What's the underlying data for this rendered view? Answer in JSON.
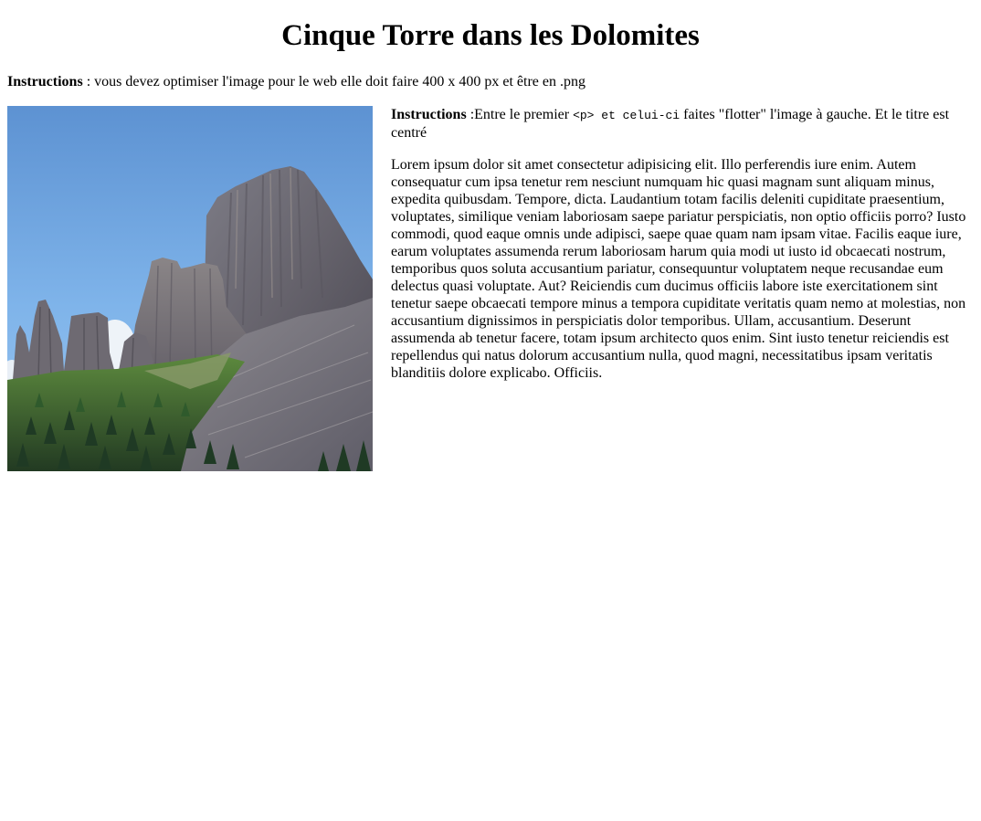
{
  "page": {
    "title": "Cinque Torre dans les Dolomites"
  },
  "intro": {
    "label": "Instructions",
    "text": " : vous devez optimiser l'image pour le web elle doit faire 400 x 400 px et être en .png"
  },
  "image": {
    "alt": "Cinque Torri mountain in the Dolomites"
  },
  "float_instructions": {
    "label": "Instructions",
    "text_before": " :Entre le premier ",
    "code": "<p> et celui-ci",
    "text_after": " faites \"flotter\" l'image à gauche. Et le titre est centré"
  },
  "body_text": "Lorem ipsum dolor sit amet consectetur adipisicing elit. Illo perferendis iure enim. Autem consequatur cum ipsa tenetur rem nesciunt numquam hic quasi magnam sunt aliquam minus, expedita quibusdam. Tempore, dicta. Laudantium totam facilis deleniti cupiditate praesentium, voluptates, similique veniam laboriosam saepe pariatur perspiciatis, non optio officiis porro? Iusto commodi, quod eaque omnis unde adipisci, saepe quae quam nam ipsam vitae. Facilis eaque iure, earum voluptates assumenda rerum laboriosam harum quia modi ut iusto id obcaecati nostrum, temporibus quos soluta accusantium pariatur, consequuntur voluptatem neque recusandae eum delectus quasi voluptate. Aut? Reiciendis cum ducimus officiis labore iste exercitationem sint tenetur saepe obcaecati tempore minus a tempora cupiditate veritatis quam nemo at molestias, non accusantium dignissimos in perspiciatis dolor temporibus. Ullam, accusantium. Deserunt assumenda ab tenetur facere, totam ipsum architecto quos enim. Sint iusto tenetur reiciendis est repellendus qui natus dolorum accusantium nulla, quod magni, necessitatibus ipsam veritatis blanditiis dolore explicabo. Officiis."
}
